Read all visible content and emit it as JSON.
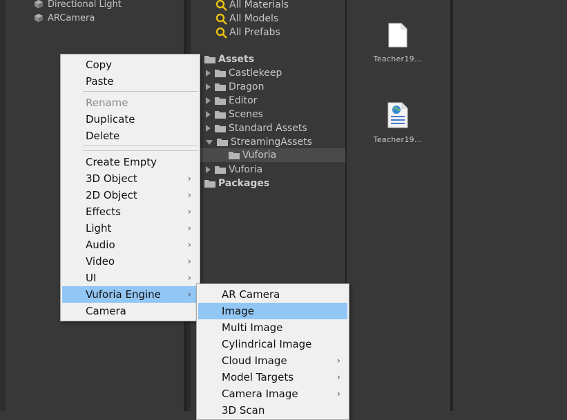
{
  "hierarchy": {
    "items": [
      {
        "label": "Directional Light"
      },
      {
        "label": "ARCamera"
      }
    ]
  },
  "project": {
    "favorites": [
      {
        "label": "All Materials"
      },
      {
        "label": "All Models"
      },
      {
        "label": "All Prefabs"
      }
    ],
    "tree": {
      "assets_label": "Assets",
      "folders": [
        {
          "label": "Castlekeep"
        },
        {
          "label": "Dragon"
        },
        {
          "label": "Editor"
        },
        {
          "label": "Scenes"
        },
        {
          "label": "Standard Assets"
        },
        {
          "label": "StreamingAssets"
        },
        {
          "label": "Vuforia"
        },
        {
          "label": "Vuforia"
        }
      ],
      "packages_label": "Packages"
    },
    "grid": {
      "items": [
        {
          "label": "Teacher19...",
          "icon": "document-icon"
        },
        {
          "label": "Teacher19...",
          "icon": "web-document-icon"
        }
      ]
    }
  },
  "context_menu": {
    "items": [
      {
        "label": "Copy"
      },
      {
        "label": "Paste"
      },
      {
        "label": "Rename",
        "disabled": true
      },
      {
        "label": "Duplicate"
      },
      {
        "label": "Delete"
      },
      {
        "label": "Create Empty"
      },
      {
        "label": "3D Object"
      },
      {
        "label": "2D Object"
      },
      {
        "label": "Effects"
      },
      {
        "label": "Light"
      },
      {
        "label": "Audio"
      },
      {
        "label": "Video"
      },
      {
        "label": "UI"
      },
      {
        "label": "Vuforia Engine",
        "highlighted": true
      },
      {
        "label": "Camera"
      }
    ],
    "submenu_glyph": "›"
  },
  "vuforia_submenu": {
    "items": [
      {
        "label": "AR Camera"
      },
      {
        "label": "Image",
        "highlighted": true
      },
      {
        "label": "Multi Image"
      },
      {
        "label": "Cylindrical Image"
      },
      {
        "label": "Cloud Image"
      },
      {
        "label": "Model Targets"
      },
      {
        "label": "Camera Image"
      },
      {
        "label": "3D Scan"
      }
    ]
  },
  "colors": {
    "panel_bg": "#383838",
    "menu_bg": "#f0f0f0",
    "menu_highlight": "#92c6f5",
    "search_icon": "#e8c010"
  }
}
